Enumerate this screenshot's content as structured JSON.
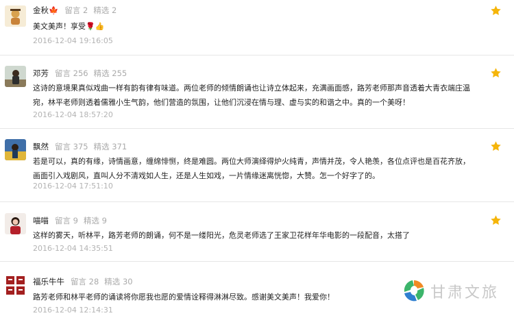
{
  "comments": [
    {
      "username": "金秋🍁",
      "messages_label": "留言 2",
      "featured_label": "精选 2",
      "text": "美文美声！享受🌹👍",
      "timestamp": "2016-12-04 19:16:05"
    },
    {
      "username": "邓芳",
      "messages_label": "留言 256",
      "featured_label": "精选 255",
      "text": "这诗的意境果真似戏曲一样有韵有律有味道。两位老师的倾情朗诵也让诗立体起来，充满画面感，路芳老师那声音透着大青衣端庄温宛，林平老师则透着儒雅小生气韵，他们营造的氛围，让他们沉浸在情与理、虚与实的和谐之中。真的一个美呀！",
      "timestamp": "2016-12-04 18:57:20"
    },
    {
      "username": "飘然",
      "messages_label": "留言 375",
      "featured_label": "精选 371",
      "text": "若是可以，真的有缘，诗情画意，缠绵悱恻，终是难圆。两位大师演绎得炉火纯青，声情并茂，令人艳羡，各位点评也是百花齐放，画面引入戏剧风，直叫人分不清戏如人生，还是人生如戏，一片情缘迷离恍惚，大赞。怎一个好字了的。",
      "timestamp": "2016-12-04 17:51:10"
    },
    {
      "username": "喵喵",
      "messages_label": "留言 9",
      "featured_label": "精选 9",
      "text": "这样的雾天，听林平，路芳老师的朗诵，何不是一缕阳光，危灵老师选了王家卫花样年华电影的一段配音，太搭了",
      "timestamp": "2016-12-04 14:35:51"
    },
    {
      "username": "福乐牛牛",
      "messages_label": "留言 28",
      "featured_label": "精选 30",
      "text": "路芳老师和林平老师的诵读将你愿我也愿的爱情诠释得淋淋尽致。感谢美文美声！我爱你！",
      "timestamp": "2016-12-04 12:14:31"
    }
  ],
  "watermark": {
    "text": "甘肃文旅"
  },
  "colors": {
    "star": "#f5b50a",
    "meta_gray": "#aaaaaa",
    "time_gray": "#b3b3b3",
    "divider": "#e6e6e6",
    "watermark_green": "#3cb56b",
    "watermark_orange": "#f08a24",
    "watermark_blue": "#2f7fd0"
  },
  "icons": {
    "star": "star-icon",
    "avatar": "avatar"
  }
}
